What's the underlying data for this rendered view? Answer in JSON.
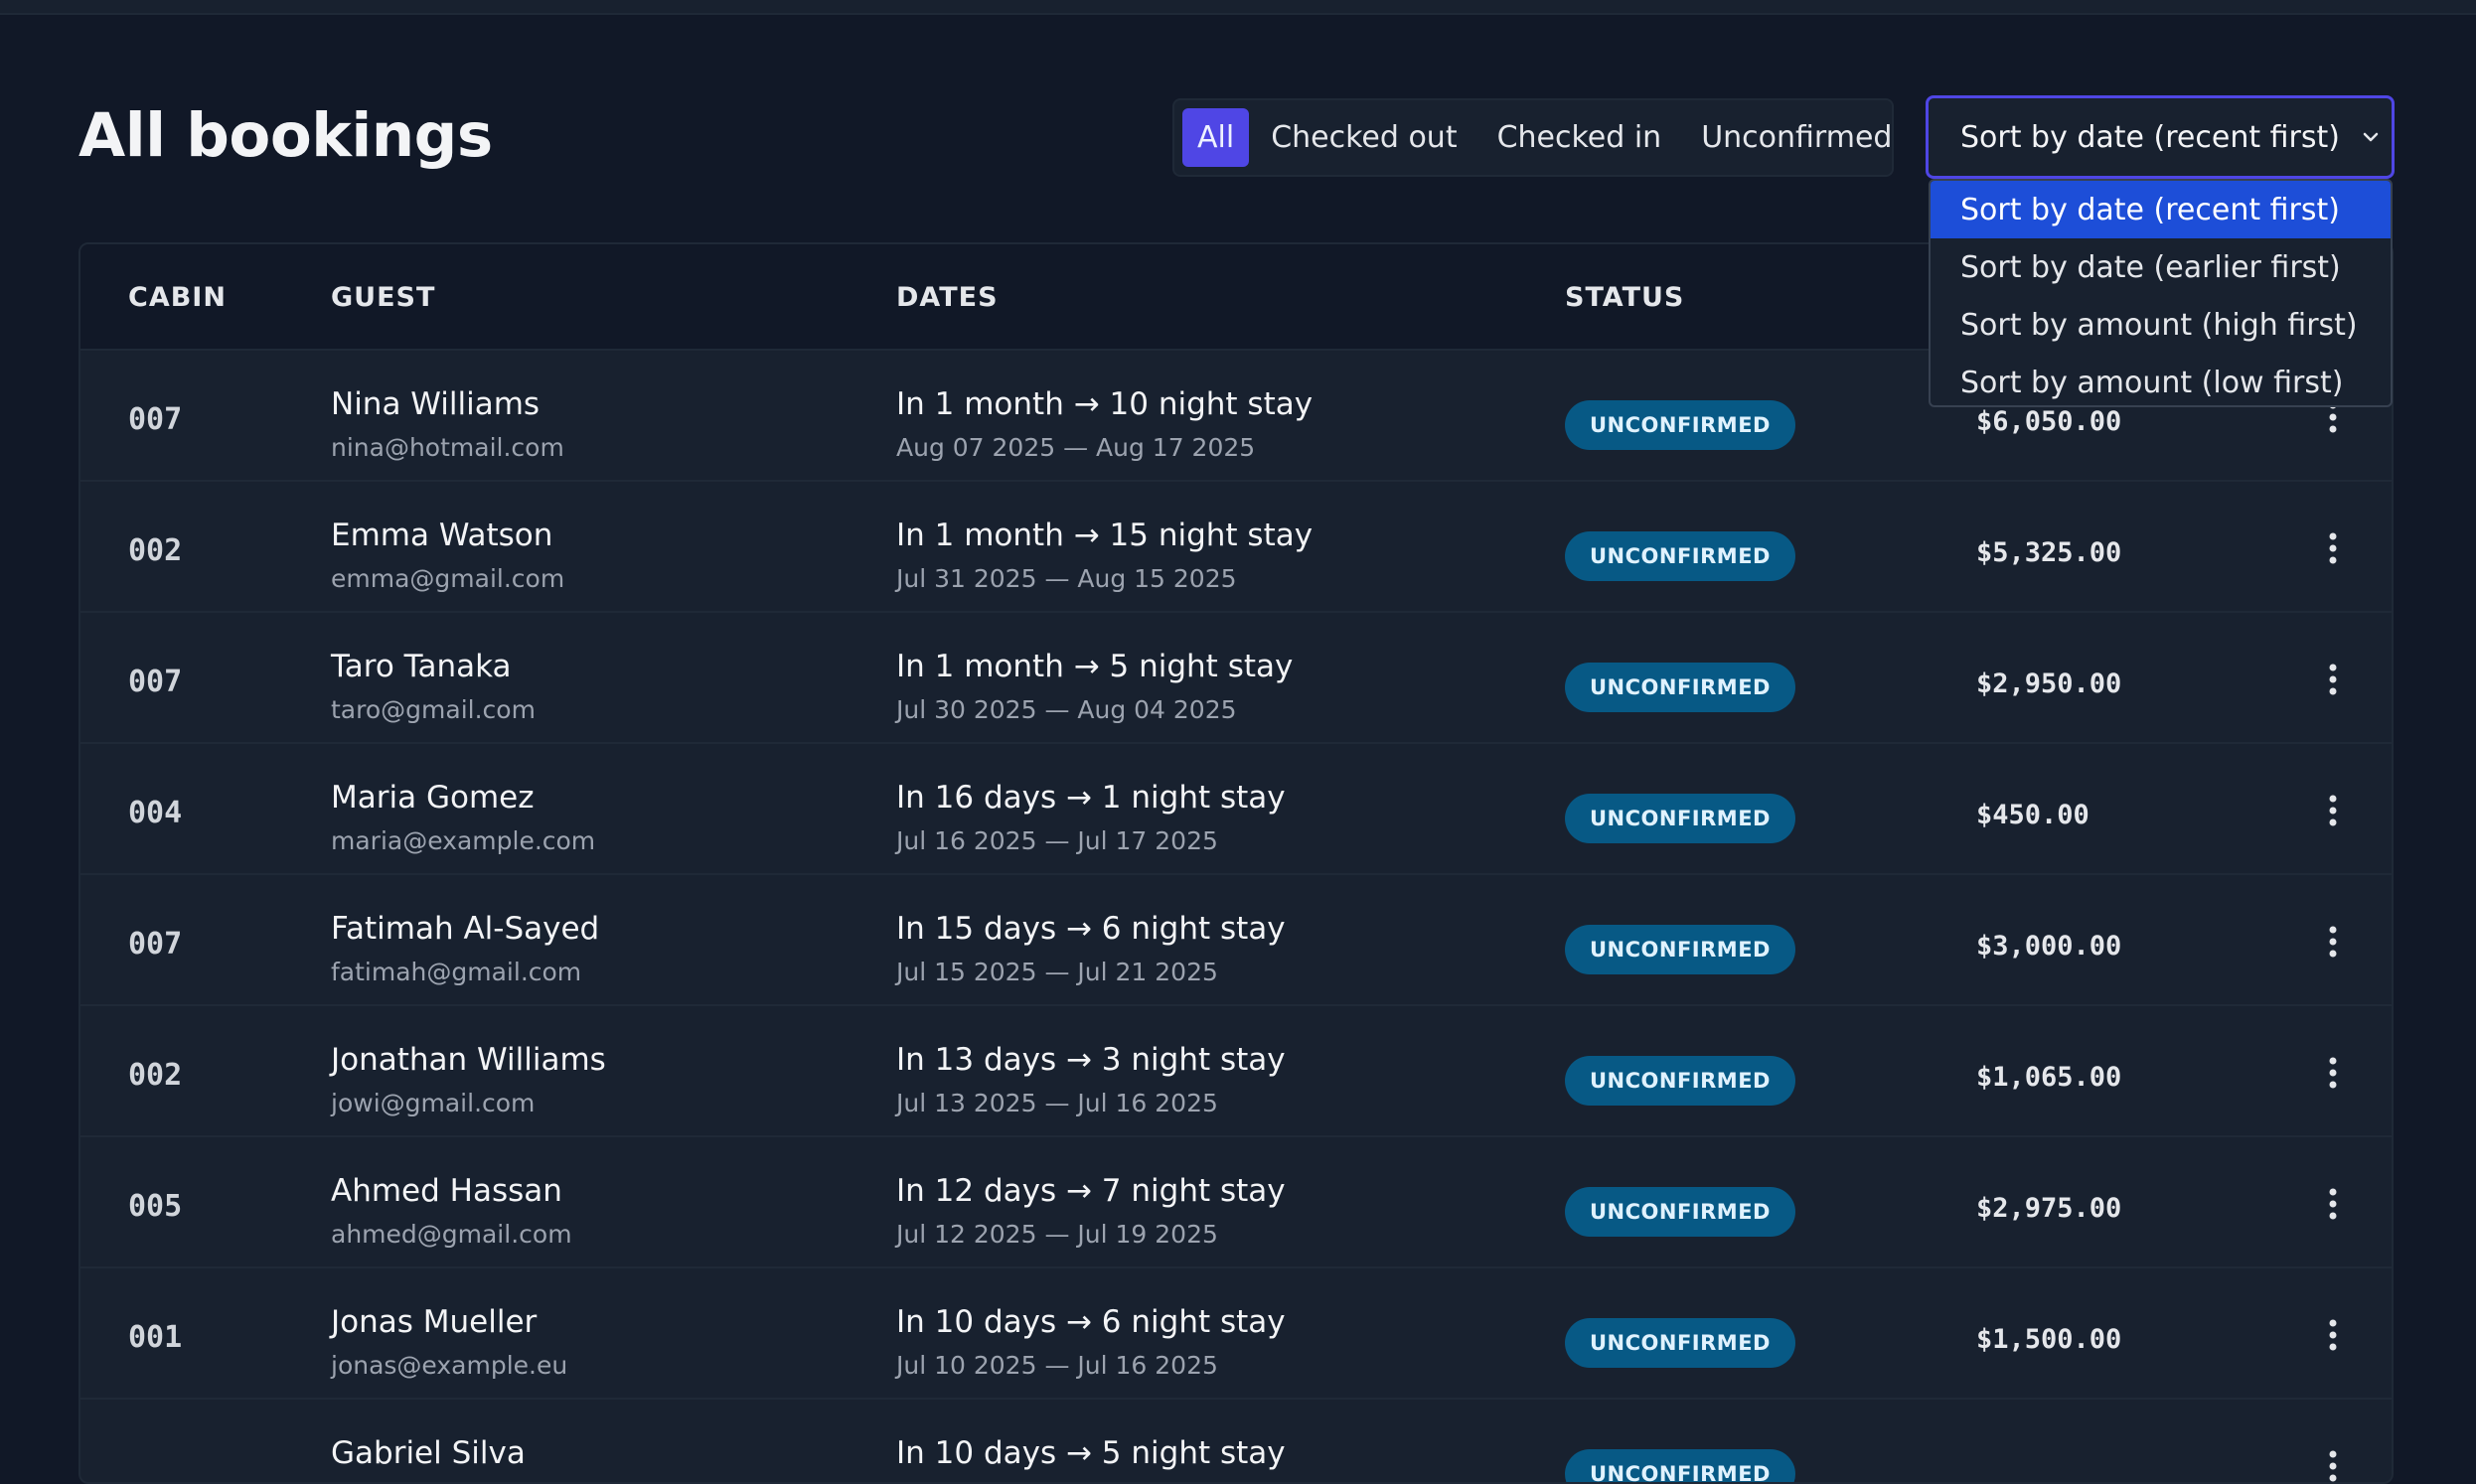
{
  "page": {
    "title": "All bookings"
  },
  "filter": {
    "options": [
      {
        "label": "All",
        "active": true
      },
      {
        "label": "Checked out",
        "active": false
      },
      {
        "label": "Checked in",
        "active": false
      },
      {
        "label": "Unconfirmed",
        "active": false
      }
    ]
  },
  "sort": {
    "selected": "Sort by date (recent first)",
    "options": [
      "Sort by date (recent first)",
      "Sort by date (earlier first)",
      "Sort by amount (high first)",
      "Sort by amount (low first)"
    ],
    "expanded": true
  },
  "table": {
    "headers": {
      "cabin": "CABIN",
      "guest": "GUEST",
      "dates": "DATES",
      "status": "STATUS"
    },
    "rows": [
      {
        "cabin": "007",
        "name": "Nina Williams",
        "email": "nina@hotmail.com",
        "stay": "In 1 month → 10 night stay",
        "range": "Aug 07 2025 — Aug 17 2025",
        "status": "UNCONFIRMED",
        "amount": "$6,050.00"
      },
      {
        "cabin": "002",
        "name": "Emma Watson",
        "email": "emma@gmail.com",
        "stay": "In 1 month → 15 night stay",
        "range": "Jul 31 2025 — Aug 15 2025",
        "status": "UNCONFIRMED",
        "amount": "$5,325.00"
      },
      {
        "cabin": "007",
        "name": "Taro Tanaka",
        "email": "taro@gmail.com",
        "stay": "In 1 month → 5 night stay",
        "range": "Jul 30 2025 — Aug 04 2025",
        "status": "UNCONFIRMED",
        "amount": "$2,950.00"
      },
      {
        "cabin": "004",
        "name": "Maria Gomez",
        "email": "maria@example.com",
        "stay": "In 16 days → 1 night stay",
        "range": "Jul 16 2025 — Jul 17 2025",
        "status": "UNCONFIRMED",
        "amount": "$450.00"
      },
      {
        "cabin": "007",
        "name": "Fatimah Al-Sayed",
        "email": "fatimah@gmail.com",
        "stay": "In 15 days → 6 night stay",
        "range": "Jul 15 2025 — Jul 21 2025",
        "status": "UNCONFIRMED",
        "amount": "$3,000.00"
      },
      {
        "cabin": "002",
        "name": "Jonathan Williams",
        "email": "jowi@gmail.com",
        "stay": "In 13 days → 3 night stay",
        "range": "Jul 13 2025 — Jul 16 2025",
        "status": "UNCONFIRMED",
        "amount": "$1,065.00"
      },
      {
        "cabin": "005",
        "name": "Ahmed Hassan",
        "email": "ahmed@gmail.com",
        "stay": "In 12 days → 7 night stay",
        "range": "Jul 12 2025 — Jul 19 2025",
        "status": "UNCONFIRMED",
        "amount": "$2,975.00"
      },
      {
        "cabin": "001",
        "name": "Jonas Mueller",
        "email": "jonas@example.eu",
        "stay": "In 10 days → 6 night stay",
        "range": "Jul 10 2025 — Jul 16 2025",
        "status": "UNCONFIRMED",
        "amount": "$1,500.00"
      },
      {
        "cabin": "",
        "name": "Gabriel Silva",
        "email": "",
        "stay": "In 10 days → 5 night stay",
        "range": "",
        "status": "UNCONFIRMED",
        "amount": ""
      }
    ]
  },
  "icons": {
    "sort_chevron": "chevron-down-icon",
    "row_menu": "more-vertical-icon"
  },
  "colors": {
    "accent": "#4f46e5",
    "selected_option": "#1d4ed8",
    "badge_bg": "#075985",
    "background": "#111827"
  }
}
